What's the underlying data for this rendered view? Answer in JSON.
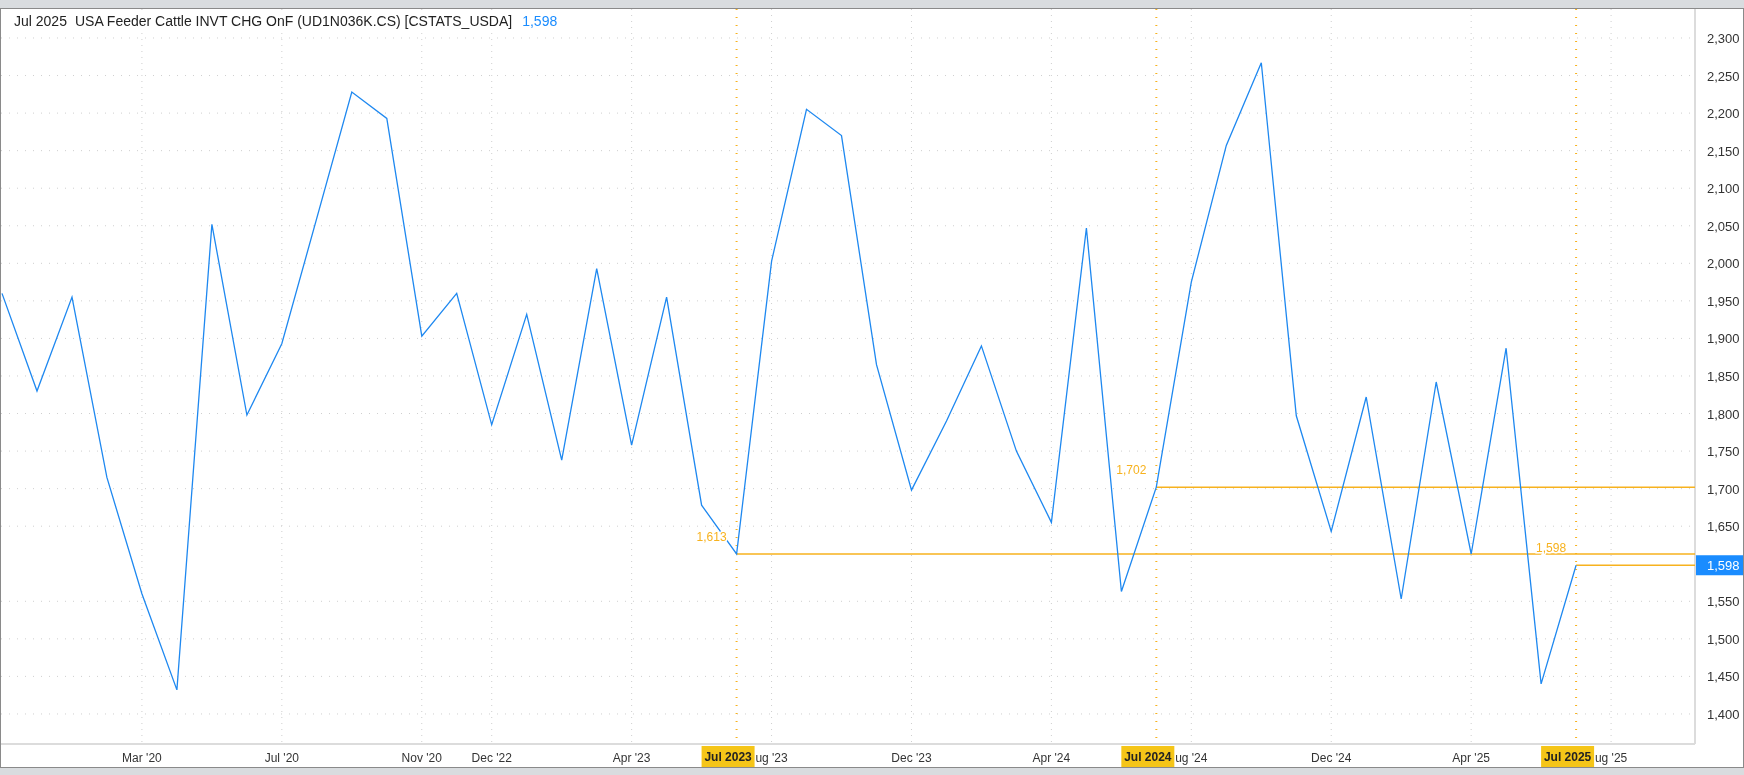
{
  "chart": {
    "title": {
      "date": "Jul 2025",
      "name": "USA Feeder Cattle INVT CHG OnF (UD1N036K.CS) [CSTATS_USDA]",
      "value": "1,598"
    },
    "price_tag": "1,598",
    "chart_data": {
      "type": "line",
      "categories": [
        null,
        null,
        null,
        null,
        "Mar '20",
        null,
        null,
        null,
        "Jul '20",
        null,
        null,
        null,
        "Nov '20",
        null,
        "Dec '22",
        null,
        null,
        null,
        "Apr '23",
        null,
        null,
        "Jul 2023",
        "ug '23",
        null,
        null,
        null,
        "Dec '23",
        null,
        null,
        null,
        "Apr '24",
        null,
        null,
        "Jul 2024",
        "ug '24",
        null,
        null,
        null,
        "Dec '24",
        null,
        null,
        null,
        "Apr '25",
        null,
        null,
        "Jul 2025",
        "ug '25"
      ],
      "series": [
        {
          "color": "#1e88f0",
          "values": [
            1960,
            1830,
            1955,
            1715,
            1560,
            1432,
            2052,
            1798,
            1893,
            2060,
            2228,
            2193,
            1903,
            1960,
            1785,
            1932,
            1738,
            1993,
            1758,
            1955,
            1678,
            1613,
            2003,
            2205,
            2170,
            1865,
            1698,
            1790,
            1890,
            1750,
            1655,
            2047,
            1563,
            1702,
            1975,
            2157,
            2267,
            1797,
            1643,
            1822,
            1553,
            1842,
            1613,
            1887,
            1440,
            1598,
            null
          ]
        }
      ],
      "ylim": [
        1360,
        2338.6
      ],
      "yticks": [
        {
          "value": 1400,
          "label": "1,400"
        },
        {
          "value": 1450,
          "label": "1,450"
        },
        {
          "value": 1500,
          "label": "1,500"
        },
        {
          "value": 1550,
          "label": "1,550"
        },
        {
          "value": 1650,
          "label": "1,650"
        },
        {
          "value": 1700,
          "label": "1,700"
        },
        {
          "value": 1750,
          "label": "1,750"
        },
        {
          "value": 1800,
          "label": "1,800"
        },
        {
          "value": 1850,
          "label": "1,850"
        },
        {
          "value": 1900,
          "label": "1,900"
        },
        {
          "value": 1950,
          "label": "1,950"
        },
        {
          "value": 2000,
          "label": "2,000"
        },
        {
          "value": 2050,
          "label": "2,050"
        },
        {
          "value": 2100,
          "label": "2,100"
        },
        {
          "value": 2150,
          "label": "2,150"
        },
        {
          "value": 2200,
          "label": "2,200"
        },
        {
          "value": 2250,
          "label": "2,250"
        },
        {
          "value": 2300,
          "label": "2,300"
        }
      ],
      "grid": true,
      "annotations": [
        {
          "x": "Jul 2023",
          "y": 1613,
          "text": "1,613"
        },
        {
          "x": "Jul 2024",
          "y": 1702,
          "text": "1,702"
        },
        {
          "x": "Jul 2025",
          "y": 1598,
          "text": "1,598"
        }
      ]
    }
  }
}
